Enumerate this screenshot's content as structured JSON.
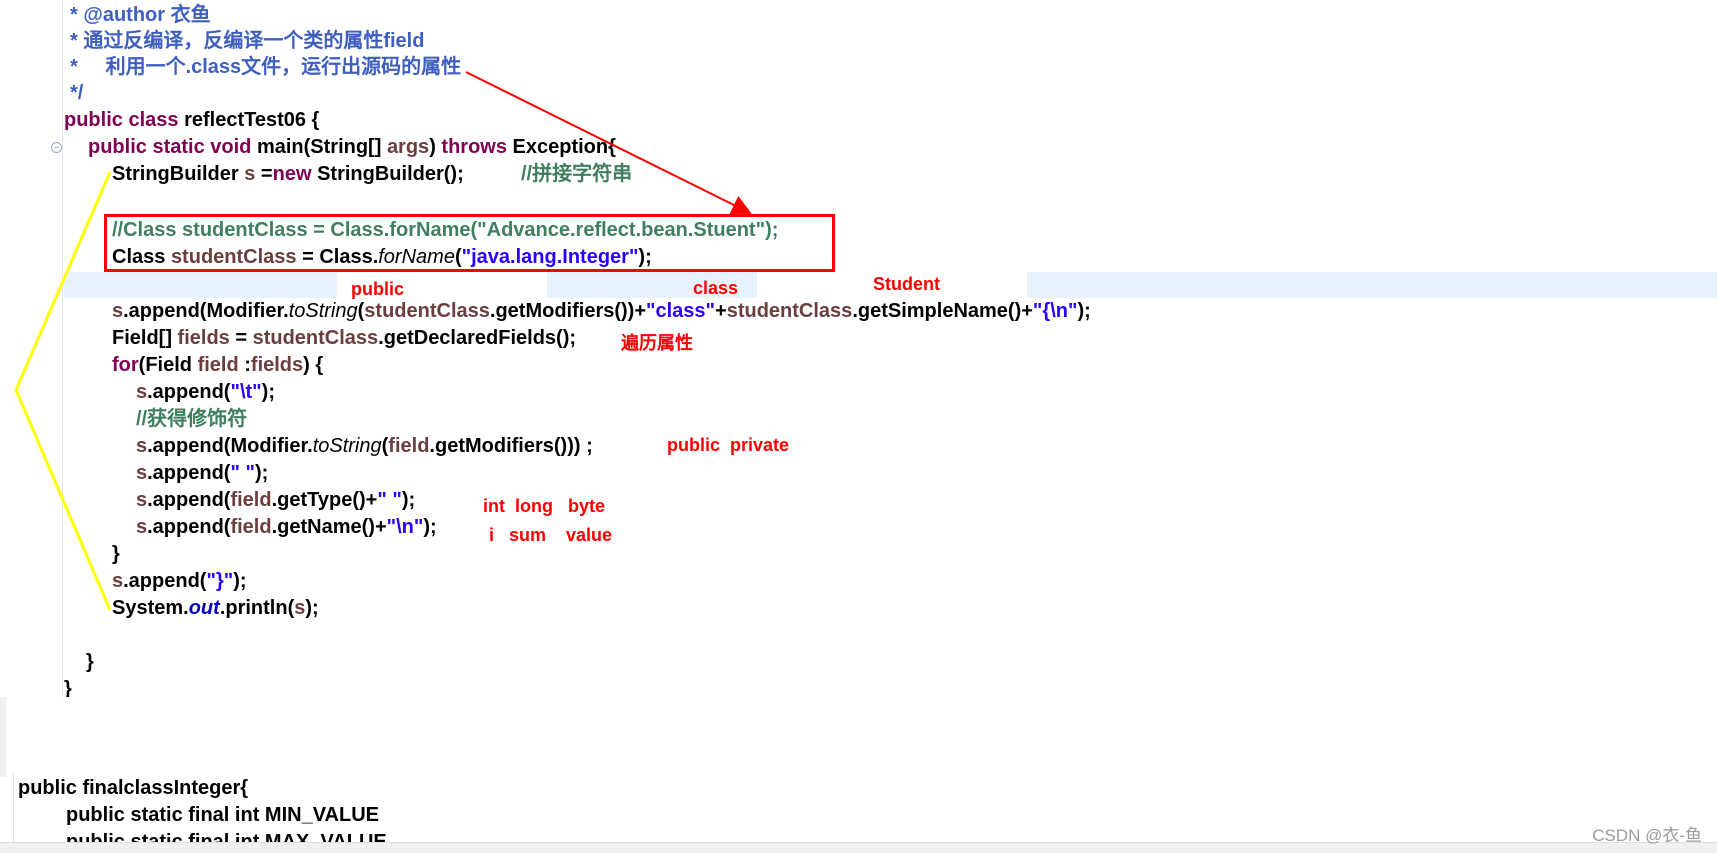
{
  "code": {
    "l1": [
      "* @author ",
      "衣鱼"
    ],
    "l2": "* 通过反编译，反编译一个类的属性field",
    "l3": "*     利用一个.class文件，运行出源码的属性",
    "l4": "*/",
    "l5": [
      "public",
      " ",
      "class",
      " reflectTest06 {"
    ],
    "l6": [
      "public",
      " ",
      "static",
      " ",
      "void",
      " main(String[] ",
      "args",
      ") ",
      "throws",
      " Exception{"
    ],
    "l7": [
      "StringBuilder ",
      "s",
      " =",
      "new",
      " StringBuilder();",
      "//拼接字符串"
    ],
    "l9": "//Class studentClass = Class.forName(\"Advance.reflect.bean.Stuent\");",
    "l10": [
      "Class ",
      "studentClass",
      " = Class.",
      "forName",
      "(",
      "\"java.lang.Integer\"",
      ");"
    ],
    "l12": [
      "s",
      ".append(Modifier.",
      "toString",
      "(",
      "studentClass",
      ".getModifiers())+",
      "\"class\"",
      "+",
      "studentClass",
      ".getSimpleName()+",
      "\"{\\n\"",
      ");"
    ],
    "l13": [
      "Field[] ",
      "fields",
      " = ",
      "studentClass",
      ".getDeclaredFields();"
    ],
    "l14": [
      "for",
      "(Field ",
      "field",
      " :",
      "fields",
      ") {"
    ],
    "l15": [
      "s",
      ".append(",
      "\"\\t\"",
      ");"
    ],
    "l16": "//获得修饰符",
    "l17": [
      "s",
      ".append(Modifier.",
      "toString",
      "(",
      "field",
      ".getModifiers())) ;"
    ],
    "l18": [
      "s",
      ".append(",
      "\" \"",
      ");"
    ],
    "l19": [
      "s",
      ".append(",
      "field",
      ".getType()+",
      "\" \"",
      ");"
    ],
    "l20": [
      "s",
      ".append(",
      "field",
      ".getName()+",
      "\"\\n\"",
      ");"
    ],
    "l21": "}",
    "l22": [
      "s",
      ".append(",
      "\"}\"",
      ");"
    ],
    "l23": [
      "System.",
      "out",
      ".println(",
      "s",
      ");"
    ],
    "l25": "}",
    "l26": "}"
  },
  "annotations": {
    "public": "public",
    "class": "class",
    "student": "Student",
    "traverse": "遍历属性",
    "modifiers": "public  private",
    "types": "int  long   byte",
    "names": "i   sum    value"
  },
  "lower": {
    "line1": "public finalclassInteger{",
    "line2": "public static final int MIN_VALUE",
    "line3": "public static final int MAX_VALUE"
  },
  "watermark": "CSDN @衣-鱼",
  "colors": {
    "keyword": "#7f0055",
    "javadoc": "#3f5fbf",
    "comment": "#3f7f5f",
    "string": "#2a00ff",
    "field": "#6a3e3e",
    "annotation": "#ff0000",
    "bracket_line": "#ffff00",
    "current_line": "#e8f2fe"
  },
  "icons": {
    "fold": "collapse-circle-icon",
    "arrow": "red-arrow",
    "bracket": "yellow-bracket"
  }
}
